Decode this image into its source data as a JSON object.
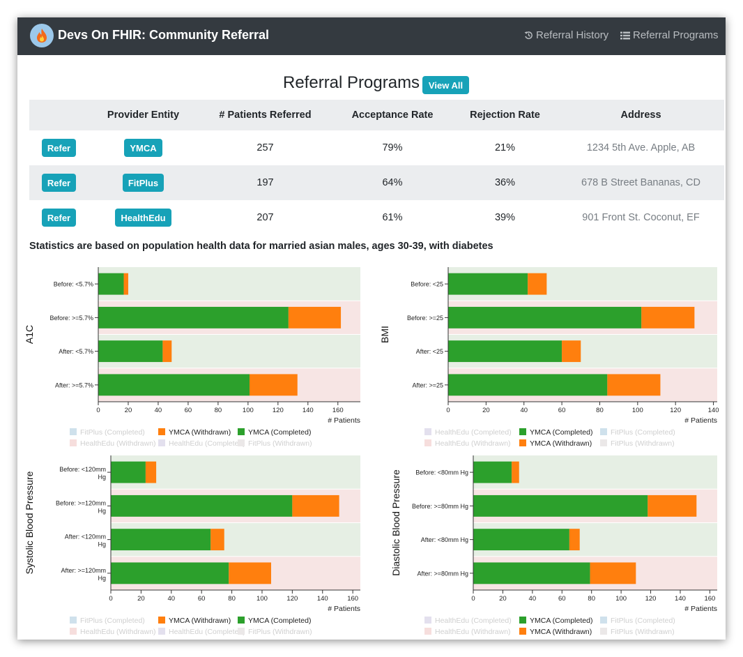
{
  "navbar": {
    "brand": "Devs On FHIR: Community Referral",
    "links": [
      "Referral History",
      "Referral Programs"
    ]
  },
  "page": {
    "title": "Referral Programs",
    "view_all": "View All"
  },
  "table": {
    "headers": [
      "",
      "Provider Entity",
      "# Patients Referred",
      "Acceptance Rate",
      "Rejection Rate",
      "Address"
    ],
    "rows": [
      {
        "action": "Refer",
        "provider": "YMCA",
        "patients": "257",
        "acceptance": "79%",
        "rejection": "21%",
        "address": "1234 5th Ave. Apple, AB"
      },
      {
        "action": "Refer",
        "provider": "FitPlus",
        "patients": "197",
        "acceptance": "64%",
        "rejection": "36%",
        "address": "678 B Street Bananas, CD"
      },
      {
        "action": "Refer",
        "provider": "HealthEdu",
        "patients": "207",
        "acceptance": "61%",
        "rejection": "39%",
        "address": "901 Front St. Coconut, EF"
      }
    ]
  },
  "stats_note": "Statistics are based on population health data for married asian males, ages 30-39, with diabetes",
  "colors": {
    "completed": "#2ca02c",
    "withdrawn": "#ff7f0e",
    "band_green": "#e6efe4",
    "band_red": "#f7e5e4",
    "accent": "#17a2b8",
    "navbar": "#343a40"
  },
  "chart_data": [
    {
      "type": "bar",
      "orientation": "horizontal",
      "stacked": true,
      "ylabel": "A1C",
      "xlabel": "# Patients",
      "xlim": [
        0,
        175
      ],
      "xticks": [
        "0",
        "20",
        "40",
        "60",
        "80",
        "100",
        "120",
        "140",
        "160"
      ],
      "categories": [
        "Before: <5.7%",
        "Before: >=5.7%",
        "After: <5.7%",
        "After: >=5.7%"
      ],
      "series": [
        {
          "name": "YMCA (Completed)",
          "values": [
            17,
            127,
            43,
            101
          ]
        },
        {
          "name": "YMCA (Withdrawn)",
          "values": [
            3,
            35,
            6,
            32
          ]
        }
      ],
      "legend": [
        [
          {
            "label": "FitPlus (Completed)",
            "active": false
          },
          {
            "label": "YMCA (Withdrawn)",
            "active": true
          },
          {
            "label": "YMCA (Completed)",
            "active": true
          }
        ],
        [
          {
            "label": "HealthEdu (Withdrawn)",
            "active": false
          },
          {
            "label": "HealthEdu (Completed)",
            "active": false
          },
          {
            "label": "FitPlus (Withdrawn)",
            "active": false
          }
        ]
      ]
    },
    {
      "type": "bar",
      "orientation": "horizontal",
      "stacked": true,
      "ylabel": "BMI",
      "xlabel": "# Patients",
      "xlim": [
        0,
        142
      ],
      "xticks": [
        "0",
        "20",
        "40",
        "60",
        "80",
        "100",
        "120",
        "140"
      ],
      "categories": [
        "Before: <25",
        "Before: >=25",
        "After: <25",
        "After: >=25"
      ],
      "series": [
        {
          "name": "YMCA (Completed)",
          "values": [
            42,
            102,
            60,
            84
          ]
        },
        {
          "name": "YMCA (Withdrawn)",
          "values": [
            10,
            28,
            10,
            28
          ]
        }
      ],
      "legend": [
        [
          {
            "label": "HealthEdu (Completed)",
            "active": false
          },
          {
            "label": "YMCA (Completed)",
            "active": true
          },
          {
            "label": "FitPlus (Completed)",
            "active": false
          }
        ],
        [
          {
            "label": "HealthEdu (Withdrawn)",
            "active": false
          },
          {
            "label": "YMCA (Withdrawn)",
            "active": true
          },
          {
            "label": "FitPlus (Withdrawn)",
            "active": false
          }
        ]
      ]
    },
    {
      "type": "bar",
      "orientation": "horizontal",
      "stacked": true,
      "ylabel": "Systolic Blood Pressure",
      "xlabel": "# Patients",
      "xlim": [
        0,
        165
      ],
      "xticks": [
        "0",
        "20",
        "40",
        "60",
        "80",
        "100",
        "120",
        "140",
        "160"
      ],
      "categories": [
        "Before: <120mm Hg",
        "Before: >=120mm Hg",
        "After: <120mm Hg",
        "After: >=120mm Hg"
      ],
      "series": [
        {
          "name": "YMCA (Completed)",
          "values": [
            23,
            120,
            66,
            78
          ]
        },
        {
          "name": "YMCA (Withdrawn)",
          "values": [
            7,
            31,
            9,
            28
          ]
        }
      ],
      "legend": [
        [
          {
            "label": "FitPlus (Completed)",
            "active": false
          },
          {
            "label": "YMCA (Withdrawn)",
            "active": true
          },
          {
            "label": "YMCA (Completed)",
            "active": true
          }
        ],
        [
          {
            "label": "HealthEdu (Withdrawn)",
            "active": false
          },
          {
            "label": "HealthEdu (Completed)",
            "active": false
          },
          {
            "label": "FitPlus (Withdrawn)",
            "active": false
          }
        ]
      ]
    },
    {
      "type": "bar",
      "orientation": "horizontal",
      "stacked": true,
      "ylabel": "Diastolic Blood Pressure",
      "xlabel": "# Patients",
      "xlim": [
        0,
        165
      ],
      "xticks": [
        "0",
        "20",
        "40",
        "60",
        "80",
        "100",
        "120",
        "140",
        "160"
      ],
      "categories": [
        "Before: <80mm Hg",
        "Before: >=80mm Hg",
        "After: <80mm Hg",
        "After: >=80mm Hg"
      ],
      "series": [
        {
          "name": "YMCA (Completed)",
          "values": [
            26,
            118,
            65,
            79
          ]
        },
        {
          "name": "YMCA (Withdrawn)",
          "values": [
            5,
            33,
            7,
            31
          ]
        }
      ],
      "legend": [
        [
          {
            "label": "HealthEdu (Completed)",
            "active": false
          },
          {
            "label": "YMCA (Completed)",
            "active": true
          },
          {
            "label": "FitPlus (Completed)",
            "active": false
          }
        ],
        [
          {
            "label": "HealthEdu (Withdrawn)",
            "active": false
          },
          {
            "label": "YMCA (Withdrawn)",
            "active": true
          },
          {
            "label": "FitPlus (Withdrawn)",
            "active": false
          }
        ]
      ]
    }
  ]
}
